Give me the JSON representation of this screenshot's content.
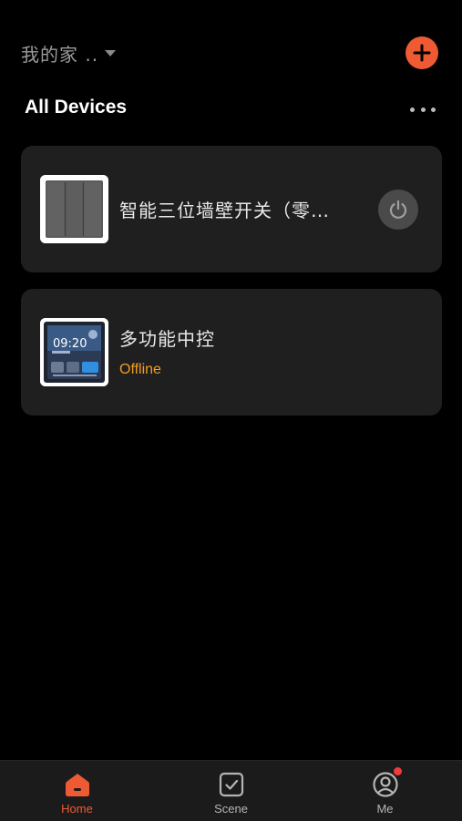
{
  "header": {
    "home_name": "我的家 ..",
    "caret_icon": "caret-down-icon",
    "add_icon": "plus-icon",
    "accent_color": "#ee5a34"
  },
  "section": {
    "title": "All Devices",
    "more_icon": "more-horizontal-icon"
  },
  "devices": [
    {
      "name": "智能三位墙壁开关（零…",
      "status": "",
      "thumbnail_icon": "three-gang-wall-switch-icon",
      "action_icon": "power-icon"
    },
    {
      "name": "多功能中控",
      "status": "Offline",
      "thumbnail_icon": "control-panel-icon",
      "thumb_time": "09:20"
    }
  ],
  "tabbar": {
    "tabs": [
      {
        "label": "Home",
        "icon": "home-icon",
        "active": true,
        "color": "#ee5a34"
      },
      {
        "label": "Scene",
        "icon": "scene-checkbox-icon",
        "active": false,
        "color": "#b5b5b5"
      },
      {
        "label": "Me",
        "icon": "user-circle-icon",
        "active": false,
        "color": "#b5b5b5",
        "badge": true
      }
    ]
  },
  "colors": {
    "background": "#000000",
    "card": "#1f1f1f",
    "status_offline": "#f29d26"
  }
}
